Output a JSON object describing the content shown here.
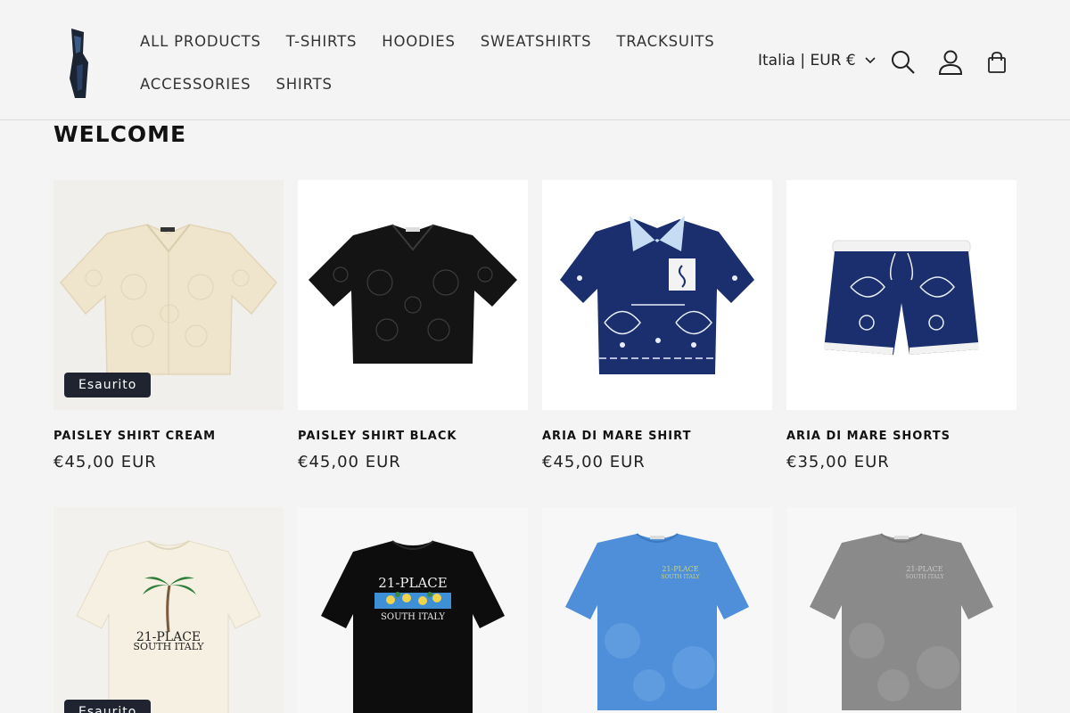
{
  "header": {
    "nav_rows": [
      [
        "ALL PRODUCTS",
        "T-SHIRTS",
        "HOODIES",
        "SWEATSHIRTS",
        "TRACKSUITS"
      ],
      [
        "ACCESSORIES",
        "SHIRTS"
      ]
    ],
    "locale": "Italia | EUR €",
    "icons": [
      "search-icon",
      "account-icon",
      "cart-icon"
    ]
  },
  "main": {
    "heading": "WELCOME",
    "products": [
      {
        "title": "PAISLEY SHIRT CREAM",
        "price": "€45,00 EUR",
        "badge": "Esaurito",
        "image": "cream-lace-shirt"
      },
      {
        "title": "PAISLEY SHIRT BLACK",
        "price": "€45,00 EUR",
        "badge": "",
        "image": "black-lace-shirt"
      },
      {
        "title": "ARIA DI MARE SHIRT",
        "price": "€45,00 EUR",
        "badge": "",
        "image": "navy-paisley-shirt"
      },
      {
        "title": "ARIA DI MARE SHORTS",
        "price": "€35,00 EUR",
        "badge": "",
        "image": "navy-paisley-shorts"
      },
      {
        "badge": "Esaurito",
        "image": "cream-palm-tshirt",
        "print": [
          "21-PLACE",
          "SOUTH ITALY"
        ]
      },
      {
        "image": "black-lemon-tshirt",
        "print": [
          "21-PLACE",
          "SOUTH ITALY"
        ]
      },
      {
        "image": "blue-washed-tshirt",
        "print": [
          "21-PLACE",
          "SOUTH ITALY"
        ]
      },
      {
        "image": "grey-washed-tshirt",
        "print": [
          "21-PLACE",
          "SOUTH ITALY"
        ]
      }
    ]
  },
  "colors": {
    "background": "#f4f4f4",
    "text": "#121212",
    "badge": "#1f2430",
    "navy": "#1b2f6e"
  }
}
